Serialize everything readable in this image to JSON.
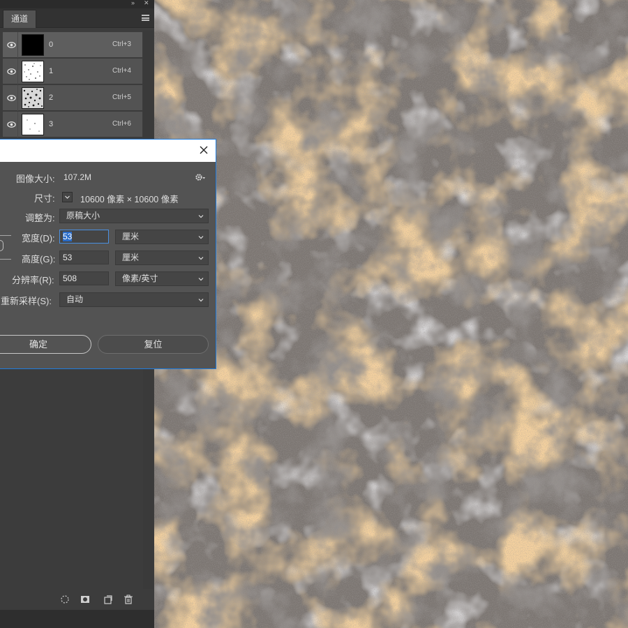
{
  "channels_panel": {
    "tab_label": "通道",
    "channels": [
      {
        "name": "0",
        "shortcut": "Ctrl+3",
        "thumbnail": "black"
      },
      {
        "name": "1",
        "shortcut": "Ctrl+4",
        "thumbnail": "speckle-light"
      },
      {
        "name": "2",
        "shortcut": "Ctrl+5",
        "thumbnail": "speckle-dense"
      },
      {
        "name": "3",
        "shortcut": "Ctrl+6",
        "thumbnail": "speckle-sparse"
      }
    ],
    "icons": [
      "collapse-icon",
      "close-icon",
      "panel-menu-icon",
      "visibility-eye-icon",
      "load-selection-icon",
      "save-selection-icon",
      "new-channel-icon",
      "trash-icon"
    ]
  },
  "image_size_dialog": {
    "image_size_label": "图像大小:",
    "image_size_value": "107.2M",
    "dimensions_label": "尺寸:",
    "dimensions_value": "10600 像素 × 10600 像素",
    "fit_to_label": "调整为:",
    "fit_to_value": "原稿大小",
    "width_label": "宽度(D):",
    "width_value": "53",
    "width_unit": "厘米",
    "height_label": "高度(G):",
    "height_value": "53",
    "height_unit": "厘米",
    "resolution_label": "分辨率(R):",
    "resolution_value": "508",
    "resolution_unit": "像素/英寸",
    "resample_label": "重新采样(S):",
    "resample_value": "自动",
    "ok_button": "确定",
    "reset_button": "复位"
  },
  "colors": {
    "panel_bg": "#3c3c3c",
    "row_bg": "#535353",
    "dialog_bg": "#535353",
    "accent_blue": "#1f7de0",
    "texture_orange": "#e8a457",
    "texture_gray": "#7a7470"
  }
}
